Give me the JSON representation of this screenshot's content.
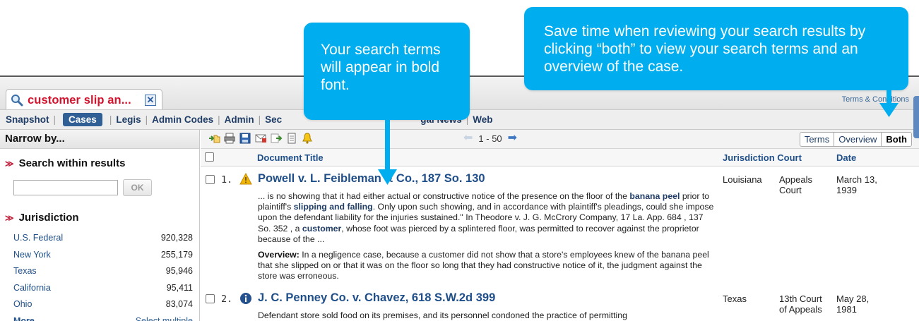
{
  "tab": {
    "label": "customer slip an...",
    "close": "✕"
  },
  "terms_link": "Terms & Conditions",
  "nav": {
    "items": [
      "Snapshot",
      "Cases",
      "Legis",
      "Admin Codes",
      "Admin",
      "Sec",
      "gal News",
      "Web"
    ],
    "active": "Cases"
  },
  "sidebar": {
    "narrow_by": "Narrow by...",
    "search_within_title": "Search within results",
    "ok_label": "OK",
    "jurisdiction_title": "Jurisdiction",
    "jurisdictions": [
      {
        "name": "U.S. Federal",
        "count": "920,328"
      },
      {
        "name": "New York",
        "count": "255,179"
      },
      {
        "name": "Texas",
        "count": "95,946"
      },
      {
        "name": "California",
        "count": "95,411"
      },
      {
        "name": "Ohio",
        "count": "83,074"
      }
    ],
    "more": "More",
    "select_multiple": "Select multiple"
  },
  "toolbar": {
    "pager": "1 - 50",
    "views": [
      "Terms",
      "Overview",
      "Both"
    ],
    "active_view": "Both"
  },
  "columns": {
    "title": "Document Title",
    "jurisdiction_court": "Jurisdiction Court",
    "date": "Date"
  },
  "results": [
    {
      "num": "1.",
      "icon": "warning-triangle-icon",
      "title": "Powell v. L. Feibleman & Co., 187 So. 130",
      "jurisdiction": "Louisiana",
      "court": [
        "Appeals",
        "Court"
      ],
      "date": [
        "March 13,",
        "1939"
      ],
      "snippet": [
        {
          "t": "... is no showing that it had either actual or constructive notice of the presence on the floor of the "
        },
        {
          "b": "banana peel"
        },
        {
          "t": " prior to plaintiff's "
        },
        {
          "b": "slipping and falling"
        },
        {
          "t": ". Only upon such showing, and in accordance with plaintiff's pleadings, could she impose upon the defendant liability for the injuries sustained.\" In Theodore v. J. G. McCrory Company, 17 La. App. 684 , 137 So. 352 , a "
        },
        {
          "b": "customer"
        },
        {
          "t": ", whose foot was pierced by a splintered floor, was permitted to recover against the proprietor because of the ..."
        }
      ],
      "overview_label": "Overview:",
      "overview": "In a negligence case, because a customer did not show that a store's employees knew of the banana peel that she slipped on or that it was on the floor so long that they had constructive notice of it, the judgment against the store was erroneous."
    },
    {
      "num": "2.",
      "icon": "info-circle-icon",
      "title": "J. C. Penney Co. v. Chavez, 618 S.W.2d 399",
      "jurisdiction": "Texas",
      "court": [
        "13th Court",
        "of Appeals"
      ],
      "date": [
        "May 28,",
        "1981"
      ],
      "snippet_text": "Defendant store sold food on its premises, and its personnel condoned the practice of permitting"
    }
  ],
  "callouts": {
    "bold_terms": "Your search terms will appear in bold font.",
    "both_view": "Save time when reviewing your search results by clicking “both” to view your search terms and an overview of the case."
  },
  "colors": {
    "callout": "#00aeef",
    "link": "#1f4f8a",
    "tab_text": "#d2142e",
    "nav_active": "#2f5f95"
  }
}
